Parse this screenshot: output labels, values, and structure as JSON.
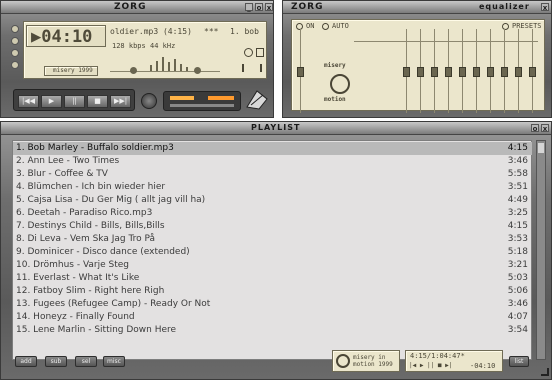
{
  "player": {
    "title": "ZORG",
    "time": "▶04:10",
    "track": "oldier.mp3 (4:15)",
    "stars": "***",
    "track_no": "1. bob",
    "kbps": "128 kbps",
    "khz": "44 kHz",
    "logo": "misery 1999",
    "controls": [
      "|◀◀",
      "▶",
      "||",
      "■",
      "▶▶|"
    ],
    "win_buttons": [
      "_",
      "o",
      "x"
    ]
  },
  "eq": {
    "title": "ZORG",
    "label": "equalizer",
    "on": "ON",
    "auto": "AUTO",
    "presets": "PRESETS",
    "logo_top": "misery",
    "logo_bottom": "motion",
    "win_buttons": [
      "x"
    ]
  },
  "playlist": {
    "title": "PLAYLIST",
    "win_buttons": [
      "o",
      "x"
    ],
    "rows": [
      {
        "label": "1. Bob Marley - Buffalo soldier.mp3",
        "dur": "4:15"
      },
      {
        "label": "2. Ann Lee - Two Times",
        "dur": "3:46"
      },
      {
        "label": "3. Blur - Coffee & TV",
        "dur": "5:58"
      },
      {
        "label": "4. Blümchen - Ich bin wieder hier",
        "dur": "3:51"
      },
      {
        "label": "5. Cajsa Lisa - Du Ger Mig ( allt jag vill ha)",
        "dur": "4:49"
      },
      {
        "label": "6. Deetah - Paradiso Rico.mp3",
        "dur": "3:25"
      },
      {
        "label": "7. Destinys Child - Bills, Bills,Bills",
        "dur": "4:15"
      },
      {
        "label": "8. Di Leva - Vem Ska Jag Tro På",
        "dur": "3:53"
      },
      {
        "label": "9. Dominicer - Disco dance (extended)",
        "dur": "5:18"
      },
      {
        "label": "10. Drömhus - Varje Steg",
        "dur": "3:21"
      },
      {
        "label": "11. Everlast - What It's Like",
        "dur": "5:03"
      },
      {
        "label": "12. Fatboy Slim - Right here Righ",
        "dur": "5:06"
      },
      {
        "label": "13. Fugees (Refugee Camp) - Ready Or Not",
        "dur": "3:46"
      },
      {
        "label": "14. Honeyz - Finally Found",
        "dur": "4:07"
      },
      {
        "label": "15. Lene Marlin - Sitting Down Here",
        "dur": "3:54"
      }
    ],
    "buttons": [
      "add",
      "sub",
      "sel",
      "misc",
      "list"
    ],
    "logo": "misery in motion 1999",
    "time": "4:15/1:04:47*",
    "remain": "-04:10",
    "mini_controls": "|◀ ▶ || ■ ▶|"
  }
}
